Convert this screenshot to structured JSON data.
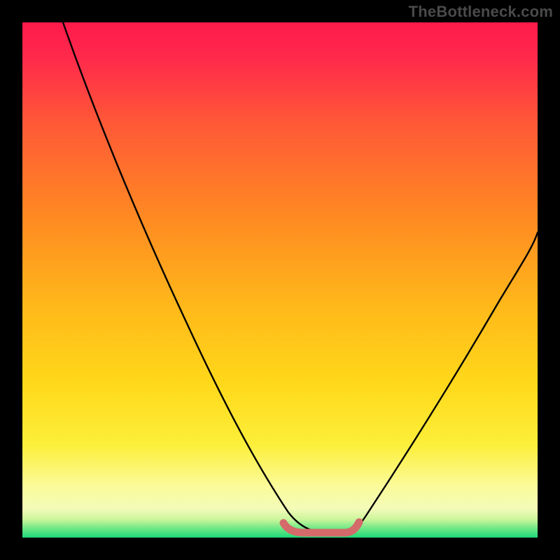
{
  "watermark": "TheBottleneck.com",
  "colors": {
    "page_bg": "#000000",
    "watermark": "#4a4a4a",
    "gradient_top": "#ff1a4b",
    "gradient_mid1": "#ff6a2a",
    "gradient_mid2": "#ffd21a",
    "gradient_mid3": "#fff99a",
    "gradient_bottom": "#1fe07a",
    "curve": "#000000",
    "marker": "#d46a6a"
  },
  "chart_data": {
    "type": "line",
    "title": "",
    "xlabel": "",
    "ylabel": "",
    "xlim": [
      0,
      100
    ],
    "ylim": [
      0,
      100
    ],
    "grid": false,
    "legend": false,
    "series": [
      {
        "name": "bottleneck-curve",
        "x": [
          8,
          12,
          16,
          20,
          24,
          28,
          32,
          36,
          40,
          44,
          48,
          50,
          52,
          54,
          56,
          58,
          60,
          62,
          64,
          68,
          72,
          76,
          80,
          84,
          88,
          92,
          96,
          100
        ],
        "y": [
          100,
          91,
          82,
          74,
          66,
          58,
          50,
          43,
          36,
          29,
          22,
          18,
          14,
          10,
          7,
          4,
          2,
          1,
          2,
          7,
          14,
          22,
          30,
          38,
          45,
          51,
          56,
          60
        ]
      }
    ],
    "optimal_band": {
      "x_start": 51,
      "x_end": 64,
      "y": 1
    },
    "annotations": [
      {
        "text": "TheBottleneck.com",
        "role": "watermark"
      }
    ]
  }
}
